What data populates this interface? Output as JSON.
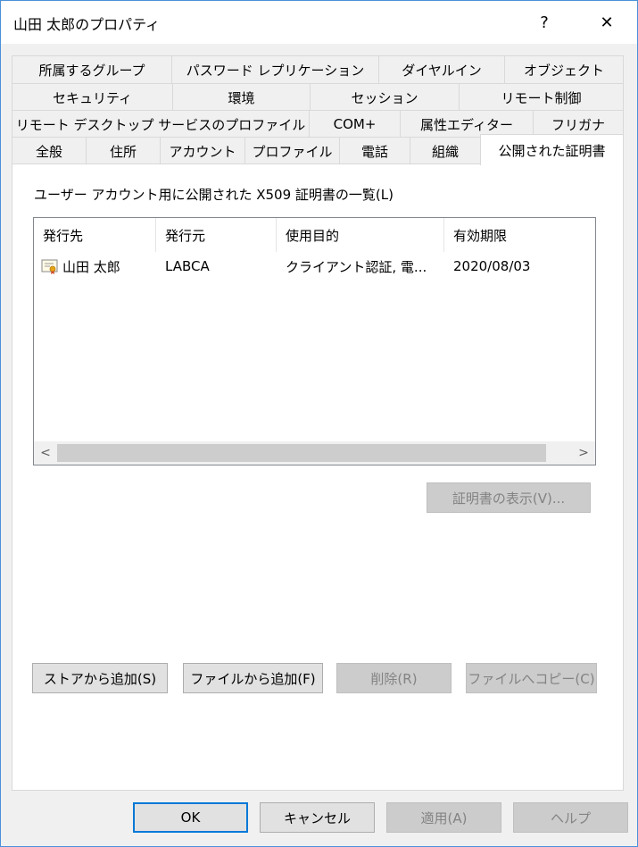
{
  "window": {
    "title": "山田 太郎のプロパティ",
    "help_glyph": "?",
    "close_glyph": "✕"
  },
  "tabs": {
    "row1": [
      "所属するグループ",
      "パスワード レプリケーション",
      "ダイヤルイン",
      "オブジェクト"
    ],
    "row2": [
      "セキュリティ",
      "環境",
      "セッション",
      "リモート制御"
    ],
    "row3": [
      "リモート デスクトップ サービスのプロファイル",
      "COM+",
      "属性エディター",
      "フリガナ"
    ],
    "row4": [
      "全般",
      "住所",
      "アカウント",
      "プロファイル",
      "電話",
      "組織",
      "公開された証明書"
    ]
  },
  "panel": {
    "label": "ユーザー アカウント用に公開された X509 証明書の一覧(L)",
    "columns": [
      "発行先",
      "発行元",
      "使用目的",
      "有効期限"
    ],
    "rows": [
      {
        "issued_to": "山田 太郎",
        "issued_by": "LABCA",
        "purpose": "クライアント認証, 電...",
        "expires": "2020/08/03",
        "icon": "certificate-icon"
      }
    ],
    "scroll_left": "<",
    "scroll_right": ">",
    "view_cert_button": "証明書の表示(V)...",
    "add_from_store_button": "ストアから追加(S)",
    "add_from_file_button": "ファイルから追加(F)",
    "remove_button": "削除(R)",
    "copy_to_file_button": "ファイルへコピー(C)"
  },
  "footer": {
    "ok": "OK",
    "cancel": "キャンセル",
    "apply": "適用(A)",
    "help": "ヘルプ"
  }
}
